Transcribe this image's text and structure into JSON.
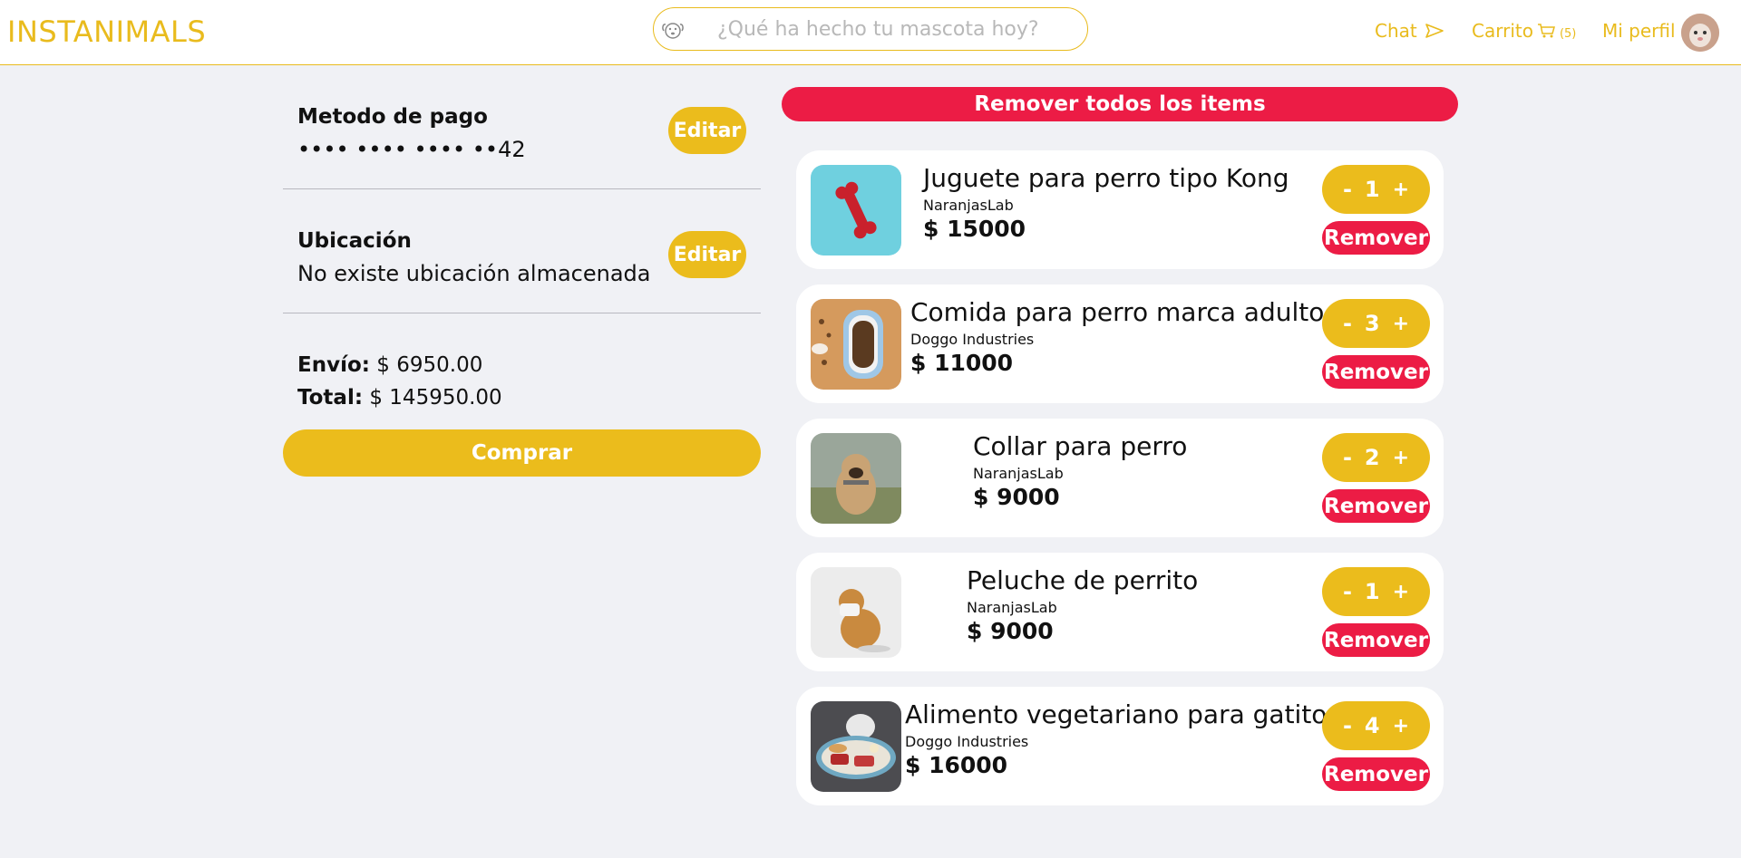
{
  "header": {
    "brand": "INSTANIMALS",
    "search_placeholder": "¿Qué ha hecho tu mascota hoy?",
    "chat_label": "Chat",
    "cart_label": "Carrito",
    "cart_count": "(5)",
    "profile_label": "Mi perfil"
  },
  "payment": {
    "title": "Metodo de pago",
    "card": "•••• •••• •••• ••42",
    "edit_label": "Editar"
  },
  "location": {
    "title": "Ubicación",
    "value": "No existe ubicación almacenada",
    "edit_label": "Editar"
  },
  "totals": {
    "shipping_label": "Envío:",
    "shipping_value": "$ 6950.00",
    "total_label": "Total:",
    "total_value": "$ 145950.00"
  },
  "buy_label": "Comprar",
  "remove_all_label": "Remover todos los items",
  "items": [
    {
      "name": "Juguete para perro tipo Kong",
      "brand": "NaranjasLab",
      "price": "$ 15000",
      "qty": "1",
      "remove_label": "Remover"
    },
    {
      "name": "Comida para perro marca adulto",
      "brand": "Doggo Industries",
      "price": "$ 11000",
      "qty": "3",
      "remove_label": "Remover"
    },
    {
      "name": "Collar para perro",
      "brand": "NaranjasLab",
      "price": "$ 9000",
      "qty": "2",
      "remove_label": "Remover"
    },
    {
      "name": "Peluche de perrito",
      "brand": "NaranjasLab",
      "price": "$ 9000",
      "qty": "1",
      "remove_label": "Remover"
    },
    {
      "name": "Alimento vegetariano para gatitos",
      "brand": "Doggo Industries",
      "price": "$ 16000",
      "qty": "4",
      "remove_label": "Remover"
    }
  ],
  "qty_minus": "-",
  "qty_plus": "+",
  "colors": {
    "accent": "#ebbc1c",
    "danger": "#ec1c45",
    "background": "#f0f1f5"
  },
  "icons": {
    "search": "dog-face-icon",
    "chat": "send-icon",
    "cart": "cart-icon"
  }
}
